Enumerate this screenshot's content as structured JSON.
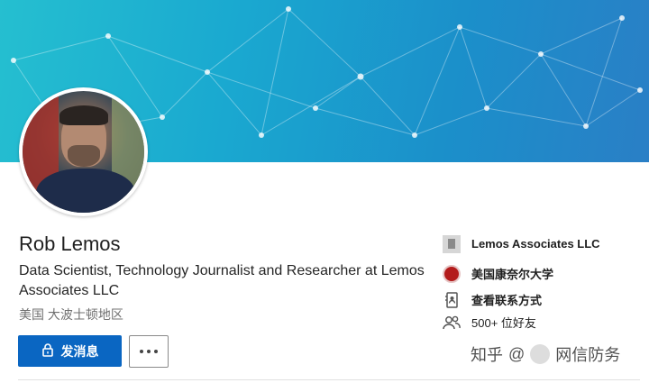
{
  "profile": {
    "name": "Rob Lemos",
    "headline": "Data Scientist, Technology Journalist and Researcher at Lemos Associates LLC",
    "location": "美国 大波士顿地区"
  },
  "actions": {
    "message_label": "发消息",
    "more_label": "…"
  },
  "side": {
    "company": "Lemos Associates LLC",
    "school": "美国康奈尔大学",
    "contact": "查看联系方式",
    "connections": "500+ 位好友"
  },
  "watermark": {
    "zhihu": "知乎",
    "handle": "@",
    "account": "网信防务"
  },
  "colors": {
    "primary_button": "#0a66c2",
    "banner_start": "#25bfd0",
    "banner_end": "#2a7fc6"
  },
  "icons": {
    "message": "lock-icon",
    "more": "ellipsis-icon",
    "company": "building-icon",
    "school": "school-seal-icon",
    "contact": "contact-card-icon",
    "connections": "people-icon"
  }
}
